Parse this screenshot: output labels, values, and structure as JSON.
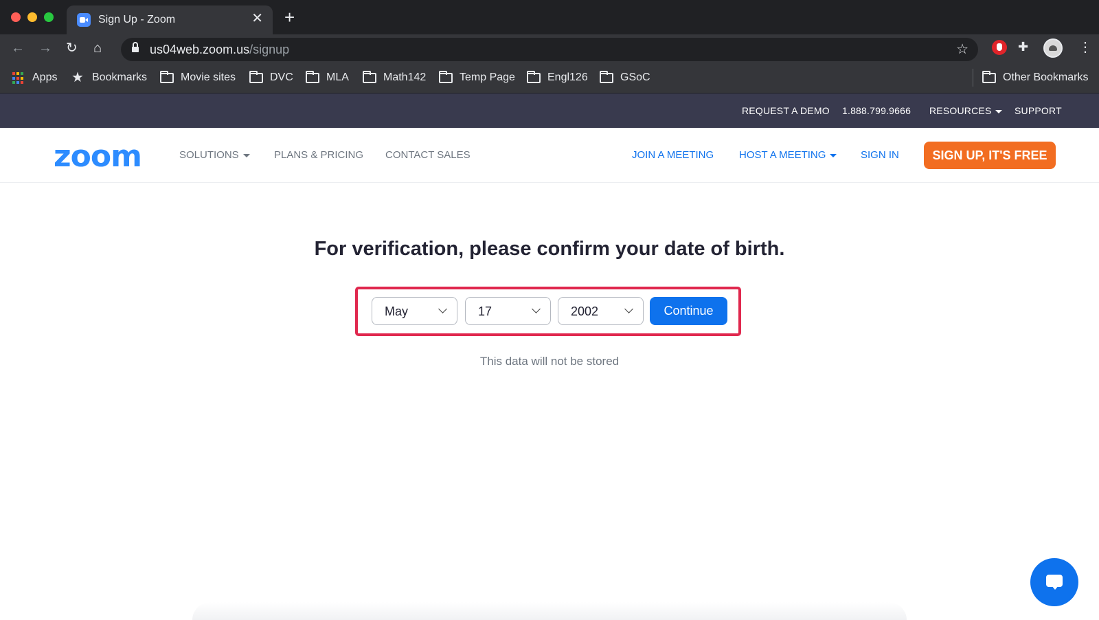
{
  "browser": {
    "tab_title": "Sign Up - Zoom",
    "tab_close": "✕",
    "new_tab": "+",
    "url_host": "us04web.zoom.us",
    "url_path": "/signup",
    "bookmarks": {
      "apps": "Apps",
      "bookmarks": "Bookmarks",
      "folders": [
        "Movie sites",
        "DVC",
        "MLA",
        "Math142",
        "Temp Page",
        "Engl126",
        "GSoC"
      ],
      "other": "Other Bookmarks"
    },
    "icons": {
      "back": "back-arrow-icon",
      "forward": "forward-arrow-icon",
      "reload": "reload-icon",
      "home": "home-icon",
      "lock": "lock-icon",
      "star": "star-icon",
      "extension_red": "adblock-extension-icon",
      "puzzle": "extensions-puzzle-icon",
      "profile": "profile-avatar",
      "menu": "kebab-menu-icon"
    }
  },
  "top_strip": {
    "request_demo": "REQUEST A DEMO",
    "phone": "1.888.799.9666",
    "resources": "RESOURCES",
    "support": "SUPPORT"
  },
  "nav": {
    "logo": "zoom",
    "solutions": "SOLUTIONS",
    "plans": "PLANS & PRICING",
    "contact_sales": "CONTACT SALES",
    "join": "JOIN A MEETING",
    "host": "HOST A MEETING",
    "sign_in": "SIGN IN",
    "sign_up": "SIGN UP, IT'S FREE"
  },
  "main": {
    "headline": "For verification, please confirm your date of birth.",
    "month": "May",
    "day": "17",
    "year": "2002",
    "continue": "Continue",
    "note": "This data will not be stored"
  },
  "colors": {
    "zoom_blue": "#0e72ed",
    "signup_orange": "#f26d21",
    "highlight_red": "#e0284e",
    "top_strip": "#393a4e"
  }
}
